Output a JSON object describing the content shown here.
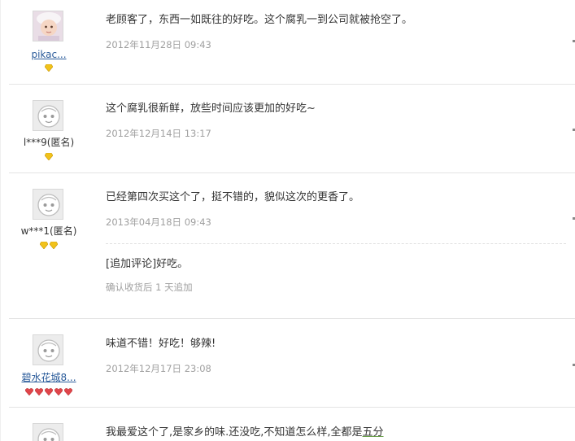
{
  "reviews": [
    {
      "username": "pikac...",
      "username_link": true,
      "badge": "yellow-diamond",
      "badge_count": 1,
      "comment": "老顾客了，东西一如既往的好吃。这个腐乳一到公司就被抢空了。",
      "date": "2012年11月28日 09:43"
    },
    {
      "username": "l***9(匿名)",
      "username_link": false,
      "badge": "yellow-diamond",
      "badge_count": 1,
      "comment": "这个腐乳很新鲜，放些时间应该更加的好吃~",
      "date": "2012年12月14日 13:17"
    },
    {
      "username": "w***1(匿名)",
      "username_link": false,
      "badge": "yellow-diamond",
      "badge_count": 2,
      "comment": "已经第四次买这个了，挺不错的，貌似这次的更香了。",
      "date": "2013年04月18日 09:43",
      "append_comment": "[追加评论]好吃。",
      "append_note": "确认收货后 1 天追加"
    },
    {
      "username": "碧水花城8...",
      "username_link": true,
      "badge": "red-heart",
      "badge_count": 5,
      "comment": "味道不错！好吃！够辣!",
      "date": "2012年12月17日 23:08"
    },
    {
      "username": "",
      "username_link": false,
      "badge_count": 0,
      "comment_pre": "我最爱这个了,是家乡的味.还没吃,不知道怎么样,全都是",
      "comment_underlined": "五分"
    }
  ],
  "colors": {
    "link": "#2a5b9a",
    "date": "#a0a0a0",
    "text": "#333333",
    "divider": "#e4e4e4",
    "yellow_diamond": "#f1c21b",
    "red_heart": "#e0454a"
  }
}
